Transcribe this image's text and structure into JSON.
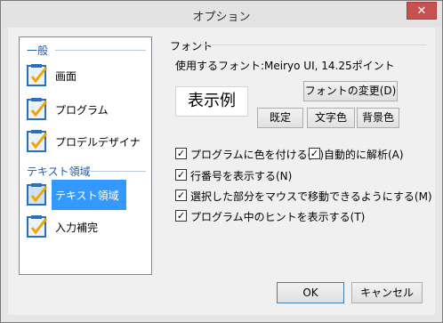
{
  "window": {
    "title": "オプション",
    "close_glyph": "✕"
  },
  "sidebar": {
    "groups": [
      {
        "header": "一般",
        "items": [
          "画面",
          "プログラム",
          "プロデルデザイナ"
        ]
      },
      {
        "header": "テキスト領域",
        "items": [
          "テキスト領域",
          "入力補完"
        ]
      }
    ],
    "selected": "テキスト領域"
  },
  "font": {
    "section_label": "フォント",
    "info": "使用するフォント:Meiryo UI, 14.25ポイント",
    "sample": "表示例",
    "change_button": "フォントの変更(D)",
    "default_button": "既定",
    "text_color_button": "文字色",
    "bg_color_button": "背景色"
  },
  "options": [
    {
      "label": "プログラムに色を付ける(H)",
      "checked": true
    },
    {
      "label": "自動的に解析(A)",
      "checked": true
    },
    {
      "label": "行番号を表示する(N)",
      "checked": true
    },
    {
      "label": "選択した部分をマウスで移動できるようにする(M)",
      "checked": true
    },
    {
      "label": "プログラム中のヒントを表示する(T)",
      "checked": true
    }
  ],
  "footer": {
    "ok": "OK",
    "cancel": "キャンセル"
  },
  "colors": {
    "accent": "#3399ff",
    "group_header": "#1e5aa8",
    "close": "#c75050"
  }
}
